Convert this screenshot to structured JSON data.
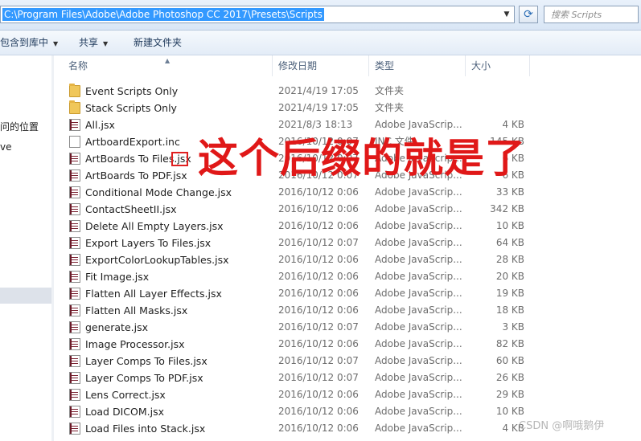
{
  "address_bar": {
    "path": "C:\\Program Files\\Adobe\\Adobe Photoshop CC 2017\\Presets\\Scripts"
  },
  "search": {
    "placeholder": "搜索 Scripts"
  },
  "toolbar": {
    "include_in_library": "包含到库中",
    "share": "共享",
    "new_folder": "新建文件夹"
  },
  "nav": {
    "item1": "问的位置",
    "item2": "ve"
  },
  "columns": {
    "name": "名称",
    "date_modified": "修改日期",
    "type": "类型",
    "size": "大小"
  },
  "files": [
    {
      "name": "Event Scripts Only",
      "date": "2021/4/19 17:05",
      "type": "文件夹",
      "size": "",
      "icon": "folder-icon"
    },
    {
      "name": "Stack Scripts Only",
      "date": "2021/4/19 17:05",
      "type": "文件夹",
      "size": "",
      "icon": "folder-icon"
    },
    {
      "name": "All.jsx",
      "date": "2021/8/3 18:13",
      "type": "Adobe JavaScrip...",
      "size": "4 KB",
      "icon": "jsx-script-icon"
    },
    {
      "name": "ArtboardExport.inc",
      "date": "2016/10/12 0:07",
      "type": "INC 文件",
      "size": "145 KB",
      "icon": "document-icon"
    },
    {
      "name": "ArtBoards To Files.jsx",
      "date": "2016/10/12 0:07",
      "type": "Adobe JavaScrip...",
      "size": "6 KB",
      "icon": "jsx-script-icon"
    },
    {
      "name": "ArtBoards To PDF.jsx",
      "date": "2016/10/12 0:07",
      "type": "Adobe JavaScrip...",
      "size": "6 KB",
      "icon": "jsx-script-icon"
    },
    {
      "name": "Conditional Mode Change.jsx",
      "date": "2016/10/12 0:06",
      "type": "Adobe JavaScrip...",
      "size": "33 KB",
      "icon": "jsx-script-icon"
    },
    {
      "name": "ContactSheetII.jsx",
      "date": "2016/10/12 0:06",
      "type": "Adobe JavaScrip...",
      "size": "342 KB",
      "icon": "jsx-script-icon"
    },
    {
      "name": "Delete All Empty Layers.jsx",
      "date": "2016/10/12 0:06",
      "type": "Adobe JavaScrip...",
      "size": "10 KB",
      "icon": "jsx-script-icon"
    },
    {
      "name": "Export Layers To Files.jsx",
      "date": "2016/10/12 0:07",
      "type": "Adobe JavaScrip...",
      "size": "64 KB",
      "icon": "jsx-script-icon"
    },
    {
      "name": "ExportColorLookupTables.jsx",
      "date": "2016/10/12 0:06",
      "type": "Adobe JavaScrip...",
      "size": "28 KB",
      "icon": "jsx-script-icon"
    },
    {
      "name": "Fit Image.jsx",
      "date": "2016/10/12 0:06",
      "type": "Adobe JavaScrip...",
      "size": "20 KB",
      "icon": "jsx-script-icon"
    },
    {
      "name": "Flatten All Layer Effects.jsx",
      "date": "2016/10/12 0:06",
      "type": "Adobe JavaScrip...",
      "size": "19 KB",
      "icon": "jsx-script-icon"
    },
    {
      "name": "Flatten All Masks.jsx",
      "date": "2016/10/12 0:06",
      "type": "Adobe JavaScrip...",
      "size": "18 KB",
      "icon": "jsx-script-icon"
    },
    {
      "name": "generate.jsx",
      "date": "2016/10/12 0:07",
      "type": "Adobe JavaScrip...",
      "size": "3 KB",
      "icon": "jsx-script-icon"
    },
    {
      "name": "Image Processor.jsx",
      "date": "2016/10/12 0:06",
      "type": "Adobe JavaScrip...",
      "size": "82 KB",
      "icon": "jsx-script-icon"
    },
    {
      "name": "Layer Comps To Files.jsx",
      "date": "2016/10/12 0:07",
      "type": "Adobe JavaScrip...",
      "size": "60 KB",
      "icon": "jsx-script-icon"
    },
    {
      "name": "Layer Comps To PDF.jsx",
      "date": "2016/10/12 0:07",
      "type": "Adobe JavaScrip...",
      "size": "26 KB",
      "icon": "jsx-script-icon"
    },
    {
      "name": "Lens Correct.jsx",
      "date": "2016/10/12 0:06",
      "type": "Adobe JavaScrip...",
      "size": "29 KB",
      "icon": "jsx-script-icon"
    },
    {
      "name": "Load DICOM.jsx",
      "date": "2016/10/12 0:06",
      "type": "Adobe JavaScrip...",
      "size": "10 KB",
      "icon": "jsx-script-icon"
    },
    {
      "name": "Load Files into Stack.jsx",
      "date": "2016/10/12 0:06",
      "type": "Adobe JavaScrip...",
      "size": "4 KB",
      "icon": "jsx-script-icon"
    }
  ],
  "annotation": {
    "text": "这个后缀的就是了",
    "color": "#e01818"
  },
  "watermark": "CSDN @啊哦鹅伊"
}
